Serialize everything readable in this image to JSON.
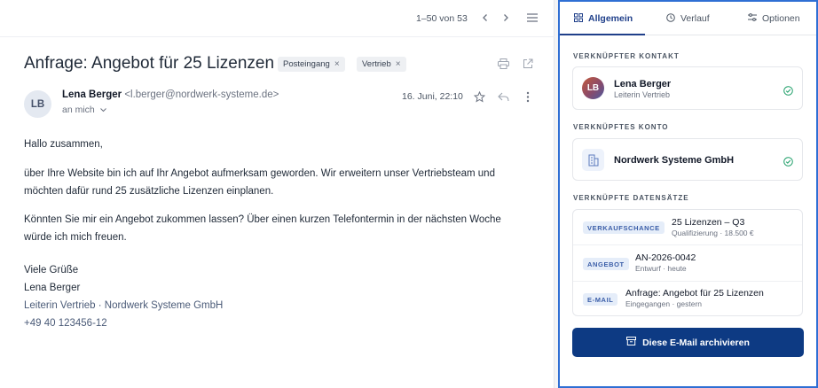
{
  "mail": {
    "pager": "1–50 von 53",
    "subject": "Anfrage: Angebot für 25 Lizenzen",
    "tags": [
      "Posteingang",
      "Vertrieb"
    ],
    "sender_initials": "LB",
    "sender_name": "Lena Berger",
    "sender_email": "<l.berger@nordwerk-systeme.de>",
    "to": "an mich",
    "date": "16. Juni, 22:10",
    "body": {
      "greeting": "Hallo zusammen,",
      "p1_line1": "über Ihre Website bin ich auf Ihr Angebot aufmerksam geworden. Wir erweitern unser Vertriebsteam und",
      "p1_line2": "möchten dafür rund 25 zusätzliche Lizenzen einplanen.",
      "p2_line1": "Könnten Sie mir ein Angebot zukommen lassen? Über einen kurzen Telefontermin in der nächsten Woche",
      "p2_line2": "würde ich mich freuen.",
      "closing": "Viele Grüße",
      "sig_name": "Lena Berger",
      "sig_role": "Leiterin Vertrieb · Nordwerk Systeme GmbH",
      "sig_phone": "+49 40 123456-12"
    }
  },
  "panel": {
    "tabs": [
      "Allgemein",
      "Verlauf",
      "Optionen"
    ],
    "active_tab": "Allgemein",
    "contact_label": "VERKNÜPFTER KONTAKT",
    "contact": {
      "initials": "LB",
      "name": "Lena Berger",
      "role": "Leiterin Vertrieb"
    },
    "account_label": "VERKNÜPFTES KONTO",
    "account": {
      "name": "Nordwerk Systeme GmbH"
    },
    "records_label": "VERKNÜPFTE DATENSÄTZE",
    "records": [
      {
        "badge": "VERKAUFSCHANCE",
        "title": "25 Lizenzen – Q3",
        "sub": "Qualifizierung · 18.500 €"
      },
      {
        "badge": "ANGEBOT",
        "title": "AN-2026-0042",
        "sub": "Entwurf · heute"
      },
      {
        "badge": "E-MAIL",
        "title": "Anfrage: Angebot für 25 Lizenzen",
        "sub": "Eingegangen · gestern"
      }
    ],
    "archive_button": "Diese E-Mail archivieren"
  },
  "colors": {
    "accent": "#0d3a83",
    "panel_border": "#2f6fd4",
    "success": "#22a06b",
    "badge_bg": "#e5edf9"
  },
  "icons": [
    "chevron-left-icon",
    "chevron-right-icon",
    "menu-icon",
    "print-icon",
    "open-external-icon",
    "star-icon",
    "reply-icon",
    "more-vertical-icon",
    "grid-icon",
    "clock-icon",
    "sliders-icon",
    "check-circle-icon",
    "building-icon",
    "archive-icon"
  ]
}
